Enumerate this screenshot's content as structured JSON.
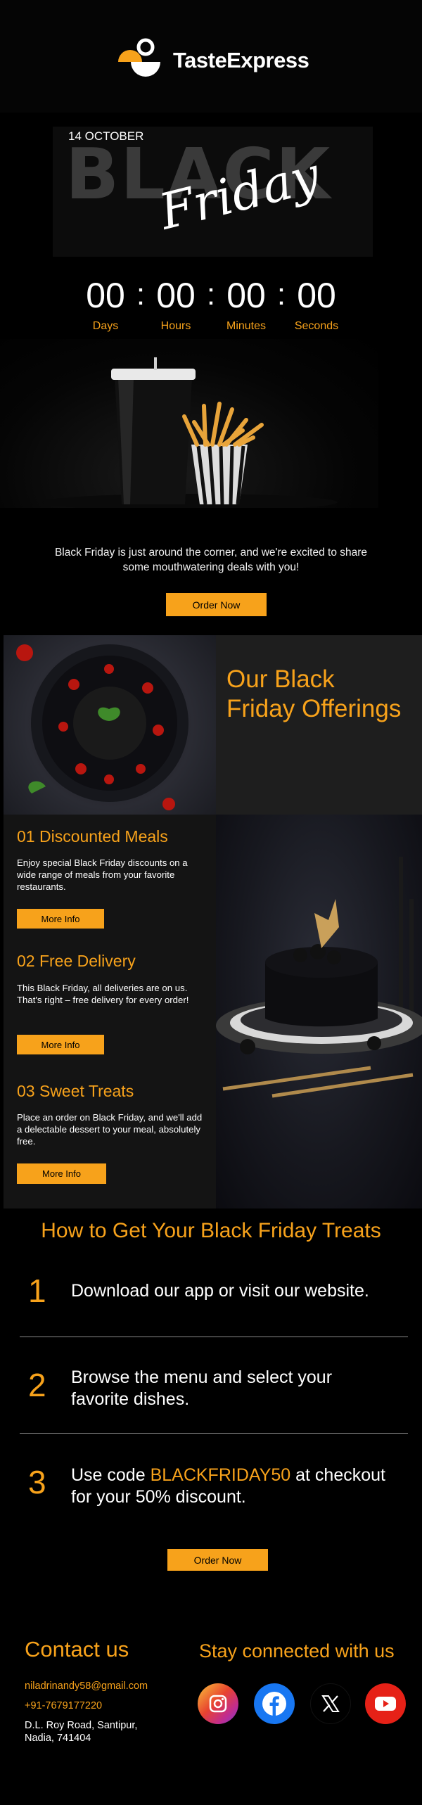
{
  "brand": {
    "name": "TasteExpress",
    "accent": "#f7a21b"
  },
  "hero": {
    "date": "14 OCTOBER",
    "word1": "BLACK",
    "word2": "Friday"
  },
  "countdown": {
    "days": "00",
    "hours": "00",
    "minutes": "00",
    "seconds": "00",
    "labels": {
      "days": "Days",
      "hours": "Hours",
      "minutes": "Minutes",
      "seconds": "Seconds"
    }
  },
  "intro": {
    "text": "Black Friday is just around the corner, and we're excited to share some mouthwatering deals with you!",
    "button": "Order Now"
  },
  "offerings": {
    "title": "Our Black Friday Offerings",
    "items": [
      {
        "title": "01 Discounted Meals",
        "text": "Enjoy special Black Friday discounts on a wide range of meals from your favorite restaurants.",
        "button": "More Info"
      },
      {
        "title": "02 Free Delivery",
        "text": "This Black Friday, all deliveries are on us. That's right – free delivery for every order!",
        "button": "More Info"
      },
      {
        "title": "03 Sweet Treats",
        "text": "Place an order on Black Friday, and we'll add a delectable dessert to your meal, absolutely free.",
        "button": "More Info"
      }
    ]
  },
  "how": {
    "title": "How to Get Your Black Friday Treats",
    "steps": [
      {
        "num": "1",
        "text": "Download our app or visit our website."
      },
      {
        "num": "2",
        "text": "Browse the menu and select your favorite dishes."
      },
      {
        "num": "3",
        "pre": "Use code ",
        "code": "BLACKFRIDAY50",
        "post": " at checkout for your 50% discount."
      }
    ],
    "button": "Order Now"
  },
  "contact": {
    "title": "Contact us",
    "email": "niladrinandy58@gmail.com",
    "phone": "+91-7679177220",
    "address_line1": "D.L. Roy Road, Santipur,",
    "address_line2": "Nadia, 741404"
  },
  "social": {
    "title": "Stay connected with us",
    "icons": [
      "instagram-icon",
      "facebook-icon",
      "x-icon",
      "youtube-icon"
    ]
  }
}
